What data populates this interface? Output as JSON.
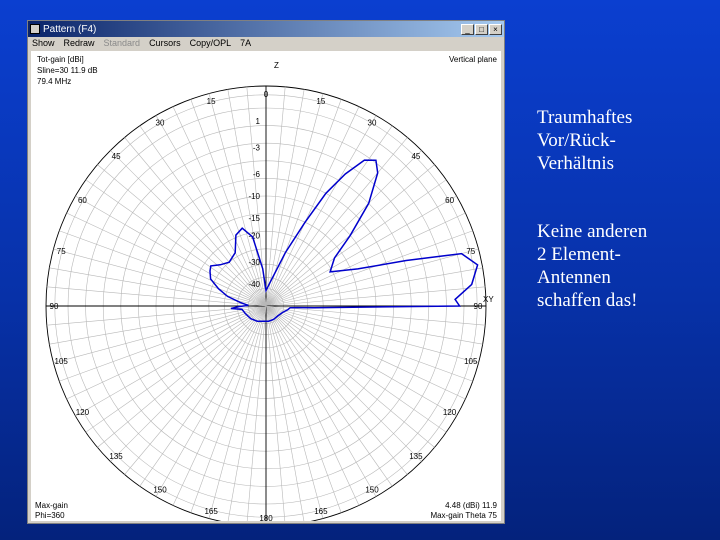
{
  "window": {
    "title": "Pattern  (F4)",
    "controls": {
      "minimize": "_",
      "maximize": "□",
      "close": "×"
    }
  },
  "menu": {
    "items": [
      {
        "label": "Show",
        "enabled": true
      },
      {
        "label": "Redraw",
        "enabled": true
      },
      {
        "label": "Standard",
        "enabled": false
      },
      {
        "label": "Cursors",
        "enabled": true
      },
      {
        "label": "Copy/OPL",
        "enabled": true
      },
      {
        "label": "7A",
        "enabled": true
      }
    ]
  },
  "plot": {
    "info_left": [
      "Tot-gain [dBi]",
      "Sline=30 11.9 dB",
      "79.4 MHz"
    ],
    "info_right": "Vertical plane",
    "top_axis": "Z",
    "right_axis": "XY",
    "bottom_left": [
      "Max-gain",
      "Phi=360"
    ],
    "bottom_right": [
      "4.48 (dBi) 11.9",
      "Max-gain Theta 75"
    ],
    "ring_labels": [
      "1",
      "-3",
      "-6",
      "-10",
      "-15",
      "-20",
      "-30",
      "-40"
    ],
    "angle_labels": {
      "0": "0",
      "15": "15",
      "30": "30",
      "45": "45",
      "60": "60",
      "75": "75",
      "90": "90",
      "105": "105",
      "120": "120",
      "135": "135",
      "150": "150",
      "165": "165",
      "180": "180",
      "-15": "15",
      "-30": "30",
      "-45": "45",
      "-60": "60",
      "-75": "75",
      "-90": "90",
      "-105": "105",
      "-120": "120",
      "-135": "135",
      "-150": "150",
      "-165": "165"
    },
    "pattern_color": "#0000cc",
    "pattern": [
      {
        "theta": 0,
        "r": 0.07
      },
      {
        "theta": 10,
        "r": 0.11
      },
      {
        "theta": 20,
        "r": 0.26
      },
      {
        "theta": 25,
        "r": 0.42
      },
      {
        "theta": 28,
        "r": 0.58
      },
      {
        "theta": 31,
        "r": 0.7
      },
      {
        "theta": 34,
        "r": 0.8
      },
      {
        "theta": 37,
        "r": 0.83
      },
      {
        "theta": 40,
        "r": 0.79
      },
      {
        "theta": 45,
        "r": 0.66
      },
      {
        "theta": 50,
        "r": 0.5
      },
      {
        "theta": 55,
        "r": 0.38
      },
      {
        "theta": 62,
        "r": 0.33
      },
      {
        "theta": 68,
        "r": 0.45
      },
      {
        "theta": 72,
        "r": 0.67
      },
      {
        "theta": 75,
        "r": 0.92
      },
      {
        "theta": 79,
        "r": 0.98
      },
      {
        "theta": 84,
        "r": 0.94
      },
      {
        "theta": 88,
        "r": 0.86
      },
      {
        "theta": 90,
        "r": 0.88
      },
      {
        "theta": 92,
        "r": 0.22
      },
      {
        "theta": 93,
        "r": 0.14
      },
      {
        "theta": 94,
        "r": 0.11
      },
      {
        "theta": 100,
        "r": 0.1
      },
      {
        "theta": 112,
        "r": 0.08
      },
      {
        "theta": 130,
        "r": 0.07
      },
      {
        "theta": 150,
        "r": 0.07
      },
      {
        "theta": 170,
        "r": 0.07
      },
      {
        "theta": 190,
        "r": 0.07
      },
      {
        "theta": 210,
        "r": 0.08
      },
      {
        "theta": 230,
        "r": 0.09
      },
      {
        "theta": 250,
        "r": 0.1
      },
      {
        "theta": 262,
        "r": 0.11
      },
      {
        "theta": 266,
        "r": 0.16
      },
      {
        "theta": 269,
        "r": 0.12
      },
      {
        "theta": 272,
        "r": 0.08
      },
      {
        "theta": 278,
        "r": 0.12
      },
      {
        "theta": 284,
        "r": 0.18
      },
      {
        "theta": 290,
        "r": 0.23
      },
      {
        "theta": 296,
        "r": 0.28
      },
      {
        "theta": 302,
        "r": 0.3
      },
      {
        "theta": 306,
        "r": 0.31
      },
      {
        "theta": 312,
        "r": 0.28
      },
      {
        "theta": 320,
        "r": 0.26
      },
      {
        "theta": 330,
        "r": 0.28
      },
      {
        "theta": 337,
        "r": 0.35
      },
      {
        "theta": 343,
        "r": 0.37
      },
      {
        "theta": 349,
        "r": 0.32
      },
      {
        "theta": 355,
        "r": 0.17
      },
      {
        "theta": 360,
        "r": 0.07
      }
    ]
  },
  "slide": {
    "block1": [
      "Traumhaftes",
      "Vor/Rück-",
      "Verhältnis"
    ],
    "block2": [
      "Keine anderen",
      "2 Element-",
      "Antennen",
      "schaffen das!"
    ]
  }
}
